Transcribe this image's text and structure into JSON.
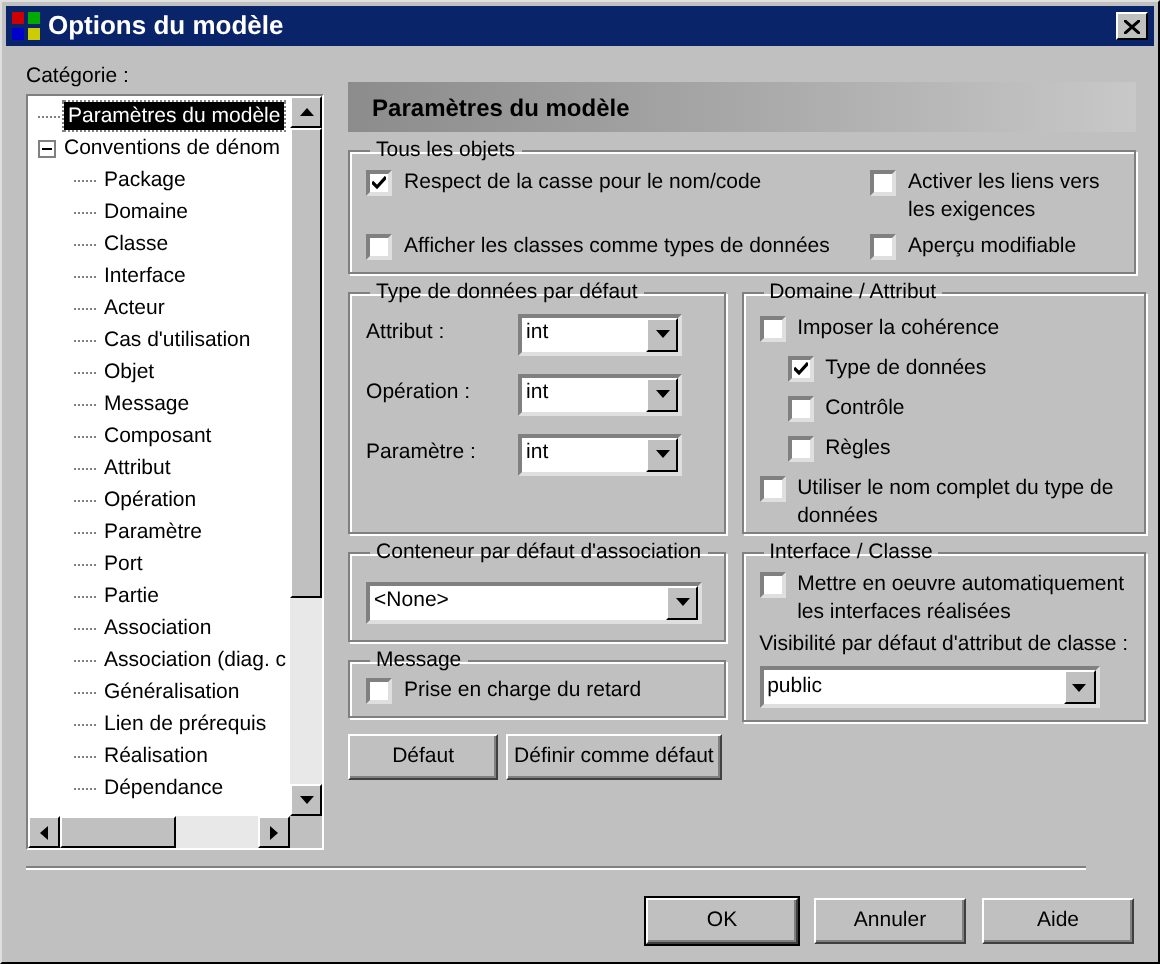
{
  "window": {
    "title": "Options du modèle"
  },
  "category_label": "Catégorie :",
  "tree": [
    {
      "label": "Paramètres du modèle",
      "selected": true
    },
    {
      "label": "Conventions de dénom",
      "selected": false,
      "expanded": true,
      "children": [
        {
          "label": "Package",
          "selected": false
        },
        {
          "label": "Domaine",
          "selected": false
        },
        {
          "label": "Classe",
          "selected": false
        },
        {
          "label": "Interface",
          "selected": false
        },
        {
          "label": "Acteur",
          "selected": false
        },
        {
          "label": "Cas d'utilisation",
          "selected": false
        },
        {
          "label": "Objet",
          "selected": false
        },
        {
          "label": "Message",
          "selected": false
        },
        {
          "label": "Composant",
          "selected": false
        },
        {
          "label": "Attribut",
          "selected": false
        },
        {
          "label": "Opération",
          "selected": false
        },
        {
          "label": "Paramètre",
          "selected": false
        },
        {
          "label": "Port",
          "selected": false
        },
        {
          "label": "Partie",
          "selected": false
        },
        {
          "label": "Association",
          "selected": false
        },
        {
          "label": "Association (diag. c",
          "selected": false
        },
        {
          "label": "Généralisation",
          "selected": false
        },
        {
          "label": "Lien de prérequis",
          "selected": false
        },
        {
          "label": "Réalisation",
          "selected": false
        },
        {
          "label": "Dépendance",
          "selected": false
        }
      ]
    }
  ],
  "header": "Paramètres du modèle",
  "all_objects": {
    "title": "Tous les objets",
    "checkboxes": [
      {
        "label": "Respect de la casse pour le nom/code",
        "checked": true
      },
      {
        "label": "Activer les liens vers les exigences",
        "checked": false
      },
      {
        "label": "Afficher les classes comme types de données",
        "checked": false
      },
      {
        "label": "Aperçu modifiable",
        "checked": false
      }
    ]
  },
  "default_types": {
    "title": "Type de données par défaut",
    "fields": [
      {
        "label": "Attribut :",
        "value": "int"
      },
      {
        "label": "Opération :",
        "value": "int"
      },
      {
        "label": "Paramètre :",
        "value": "int"
      }
    ]
  },
  "domain_attribute": {
    "title": "Domaine / Attribut",
    "checkboxes": [
      {
        "label": "Imposer la cohérence",
        "checked": false,
        "children": [
          {
            "label": "Type de données",
            "checked": true
          },
          {
            "label": "Contrôle",
            "checked": false
          },
          {
            "label": "Règles",
            "checked": false
          }
        ]
      },
      {
        "label": "Utiliser le nom complet du type de données",
        "checked": false
      }
    ]
  },
  "association_container": {
    "title": "Conteneur par défaut d'association",
    "value": "<None>"
  },
  "interface_class": {
    "title": "Interface / Classe",
    "checkboxes": [
      {
        "label": "Mettre en oeuvre automatiquement les interfaces réalisées",
        "checked": false
      }
    ],
    "visibility_label": "Visibilité par défaut d'attribut de classe :",
    "visibility_value": "public"
  },
  "message": {
    "title": "Message",
    "checkboxes": [
      {
        "label": "Prise en charge du retard",
        "checked": false
      }
    ]
  },
  "panel_buttons": [
    "Défaut",
    "Définir comme défaut"
  ],
  "dialog_buttons": [
    {
      "label": "OK",
      "default": true
    },
    {
      "label": "Annuler",
      "default": false
    },
    {
      "label": "Aide",
      "default": false
    }
  ]
}
